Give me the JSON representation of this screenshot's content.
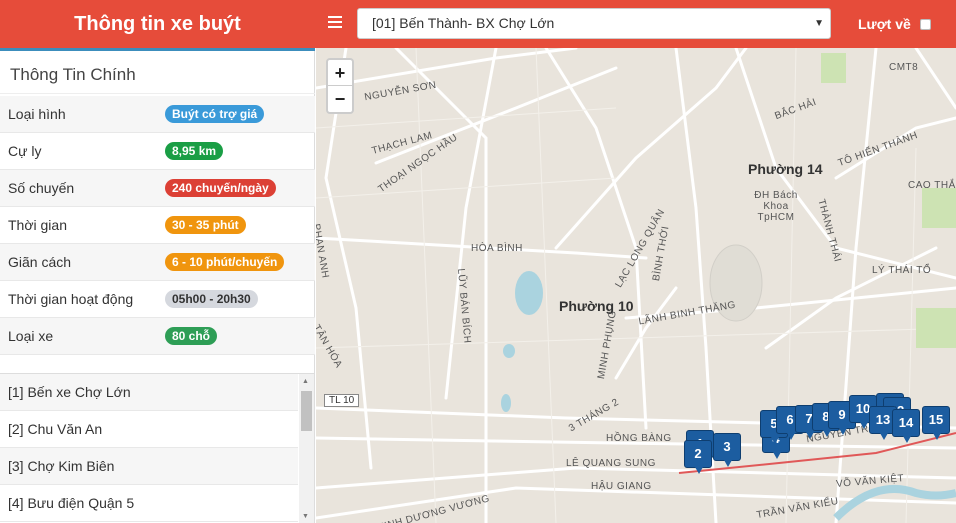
{
  "header": {
    "title": "Thông tin xe buýt",
    "route_selected": "[01] Bến Thành- BX Chợ Lớn",
    "return_label": "Lượt về"
  },
  "info": {
    "title": "Thông Tin Chính",
    "rows": [
      {
        "label": "Loại hình",
        "value": "Buýt có trợ giá",
        "color": "#3a9ad9"
      },
      {
        "label": "Cự ly",
        "value": "8,95 km",
        "color": "#1a9e45"
      },
      {
        "label": "Số chuyến",
        "value": "240 chuyến/ngày",
        "color": "#dc4035"
      },
      {
        "label": "Thời gian",
        "value": "30 - 35 phút",
        "color": "#f0950e"
      },
      {
        "label": "Giãn cách",
        "value": "6 - 10 phút/chuyến",
        "color": "#f0950e"
      },
      {
        "label": "Thời gian hoạt động",
        "value": "05h00 - 20h30",
        "color": "#d5d8de",
        "text_color": "#333"
      },
      {
        "label": "Loại xe",
        "value": "80 chỗ",
        "color": "#2e9e56"
      }
    ]
  },
  "stops": [
    "[1] Bến xe Chợ Lớn",
    "[2] Chu Văn An",
    "[3] Chợ Kim Biên",
    "[4] Bưu điện Quận 5"
  ],
  "map": {
    "zoom_in": "+",
    "zoom_out": "−",
    "areas": [
      "Phường 14",
      "Phường 10"
    ],
    "poi": "ĐH Bách Khoa TpHCM",
    "road_badge": "TL 10",
    "streets": [
      "NGUYỄN SƠN",
      "THẠCH LAM",
      "THOẠI NGỌC HẦU",
      "HÒA BÌNH",
      "PHAN ANH",
      "TÂN HÓA",
      "LŨY BÁN BÍCH",
      "LẠC LONG QUÂN",
      "BÌNH THỚI",
      "LÃNH BINH THĂNG",
      "3 THÁNG 2",
      "HỒNG BÀNG",
      "LÊ QUANG SUNG",
      "HẬU GIANG",
      "MINH PHỤNG",
      "KINH DƯƠNG VƯƠNG",
      "LÝ THÁI TỔ",
      "THÀNH THÁI",
      "CAO THẮNG",
      "TRẦN VĂN KIỂU",
      "VÕ VĂN KIỆT",
      "BẮC HẢI",
      "CMT8",
      "TÔ HIẾN THÀNH",
      "NGUYỄN TRÃI"
    ],
    "markers": [
      "1",
      "2",
      "3",
      "4",
      "5",
      "6",
      "7",
      "8",
      "9",
      "10",
      "11",
      "12",
      "13",
      "14",
      "15"
    ]
  }
}
